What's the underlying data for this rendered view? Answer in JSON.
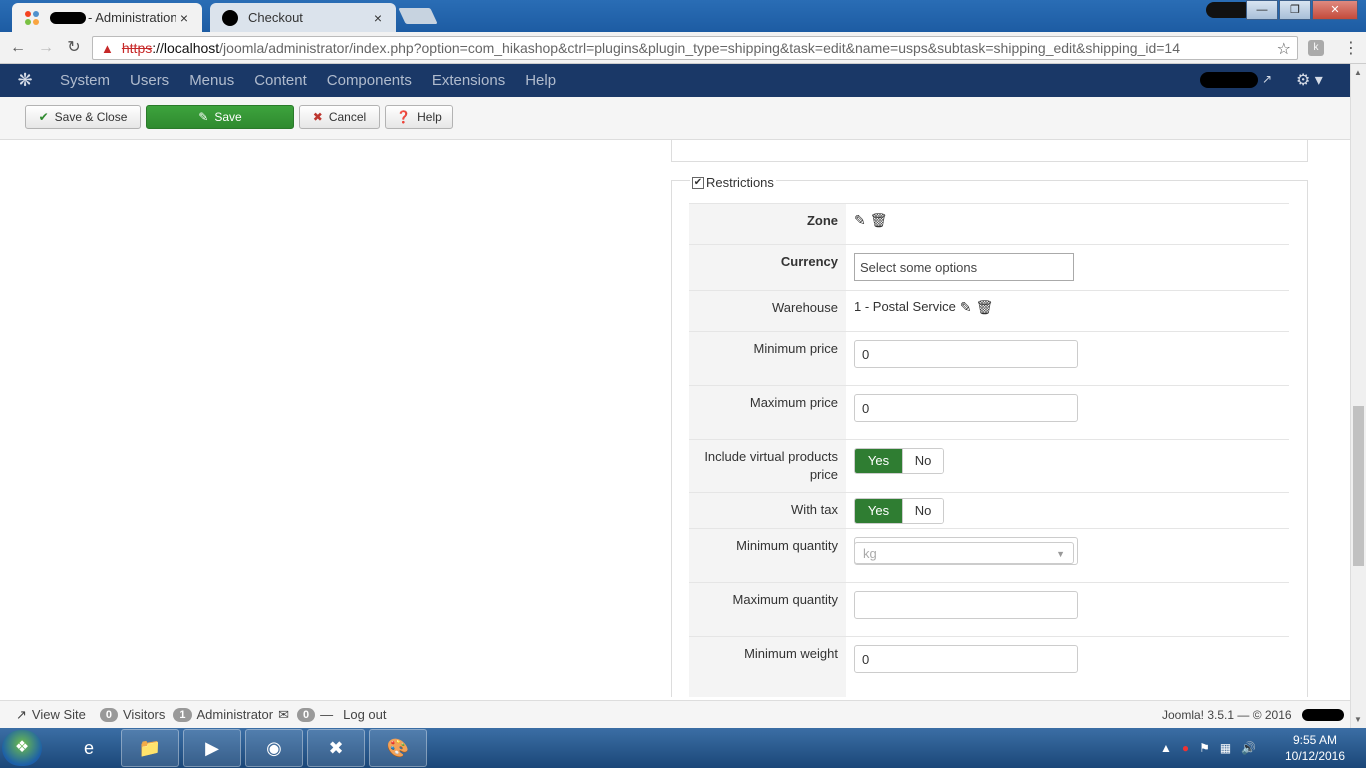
{
  "browser": {
    "tabs": [
      {
        "title": "- Administration",
        "close": "×"
      },
      {
        "title": "Checkout",
        "close": "×"
      }
    ],
    "url": {
      "scheme": "https",
      "host": "://localhost",
      "rest": "/joomla/administrator/index.php?option=com_hikashop&ctrl=plugins&plugin_type=shipping&task=edit&name=usps&subtask=shipping_edit&shipping_id=14"
    }
  },
  "joomla_nav": {
    "items": [
      "System",
      "Users",
      "Menus",
      "Content",
      "Components",
      "Extensions",
      "Help"
    ]
  },
  "toolbar": {
    "save_close": "Save & Close",
    "save": "Save",
    "cancel": "Cancel",
    "help": "Help"
  },
  "restrictions": {
    "legend": "Restrictions",
    "zone_label": "Zone",
    "currency_label": "Currency",
    "currency_placeholder": "Select some options",
    "warehouse_label": "Warehouse",
    "warehouse_value": "1 - Postal Service",
    "min_price_label": "Minimum price",
    "min_price_value": "0",
    "max_price_label": "Maximum price",
    "max_price_value": "0",
    "virtual_label": "Include virtual products price",
    "with_tax_label": "With tax",
    "yes": "Yes",
    "no": "No",
    "min_qty_label": "Minimum quantity",
    "min_qty_value": "",
    "max_qty_label": "Maximum quantity",
    "max_qty_value": "",
    "min_weight_label": "Minimum weight",
    "min_weight_value": "0",
    "weight_unit": "kg"
  },
  "statusbar": {
    "view_site": "View Site",
    "visitors_count": "0",
    "visitors": "Visitors",
    "admin_count": "1",
    "administrator": "Administrator",
    "messages_count": "0",
    "logout": "Log out",
    "version": "Joomla! 3.5.1 — © 2016"
  },
  "taskbar": {
    "time": "9:55 AM",
    "date": "10/12/2016"
  },
  "colors": {
    "joomla_nav": "#1a3867",
    "save_green": "#2f8a2f",
    "yes_green": "#2f7d32"
  }
}
